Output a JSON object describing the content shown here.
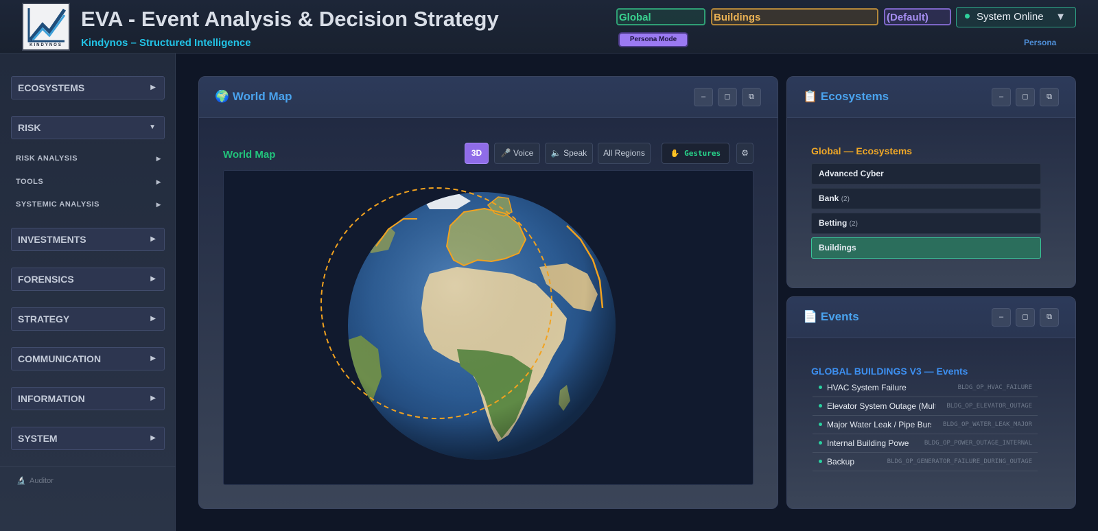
{
  "header": {
    "logo_text": "KINDYNOS",
    "title": "EVA - Event Analysis & Decision Strategy",
    "subtitle": "Kindynos – Structured Intelligence",
    "chips": {
      "global": "Global",
      "buildings": "Buildings",
      "default": "(Default)"
    },
    "status": {
      "label": "System Online",
      "chevron": "▼"
    },
    "persona_mode": "Persona Mode",
    "persona_link": "Persona"
  },
  "sidebar": {
    "sections": [
      {
        "label": "ECOSYSTEMS",
        "arrow": "▶"
      },
      {
        "label": "RISK",
        "arrow": "▼"
      },
      {
        "label": "INVESTMENTS",
        "arrow": "▶"
      },
      {
        "label": "FORENSICS",
        "arrow": "▶"
      },
      {
        "label": "STRATEGY",
        "arrow": "▶"
      },
      {
        "label": "COMMUNICATION",
        "arrow": "▶"
      },
      {
        "label": "INFORMATION",
        "arrow": "▶"
      },
      {
        "label": "SYSTEM",
        "arrow": "▶"
      }
    ],
    "risk_items": [
      {
        "label": "RISK ANALYSIS",
        "arrow": "▶"
      },
      {
        "label": "TOOLS",
        "arrow": "▶"
      },
      {
        "label": "SYSTEMIC ANALYSIS",
        "arrow": "▶"
      }
    ],
    "footer": {
      "icon": "🔬",
      "label": "Auditor"
    }
  },
  "window_controls": {
    "minimize": "–",
    "maximize": "◻",
    "popout": "⧉"
  },
  "map_panel": {
    "icon": "🌍",
    "title": "World Map",
    "label": "World Map",
    "tools": {
      "mode_3d": "3D",
      "voice": "🎤 Voice",
      "speak": "🔈 Speak",
      "regions": "All Regions",
      "gestures": "✋ Gestures",
      "settings": "⚙"
    }
  },
  "ecosystems_panel": {
    "icon": "📋",
    "title": "Ecosystems",
    "heading": "Global — Ecosystems",
    "items": [
      {
        "name": "Advanced Cyber",
        "count": ""
      },
      {
        "name": "Bank",
        "count": "(2)"
      },
      {
        "name": "Betting",
        "count": "(2)"
      },
      {
        "name": "Buildings",
        "count": "",
        "selected": true
      }
    ]
  },
  "events_panel": {
    "icon": "📄",
    "title": "Events",
    "heading": "GLOBAL BUILDINGS V3 — Events",
    "items": [
      {
        "name": "HVAC System Failure",
        "code": "BLDG_OP_HVAC_FAILURE"
      },
      {
        "name": "Elevator System Outage (Mult",
        "code": "BLDG_OP_ELEVATOR_OUTAGE"
      },
      {
        "name": "Major Water Leak / Pipe Burs",
        "code": "BLDG_OP_WATER_LEAK_MAJOR"
      },
      {
        "name": "Internal Building Power",
        "code": "BLDG_OP_POWER_OUTAGE_INTERNAL"
      },
      {
        "name": "Backup",
        "code": "BLDG_OP_GENERATOR_FAILURE_DURING_OUTAGE"
      }
    ]
  },
  "colors": {
    "accent_blue": "#4aa3ee",
    "accent_green": "#22c27b",
    "accent_orange": "#f0a827",
    "accent_purple": "#8f6ce8",
    "highlight_outline": "#f2a21f"
  }
}
